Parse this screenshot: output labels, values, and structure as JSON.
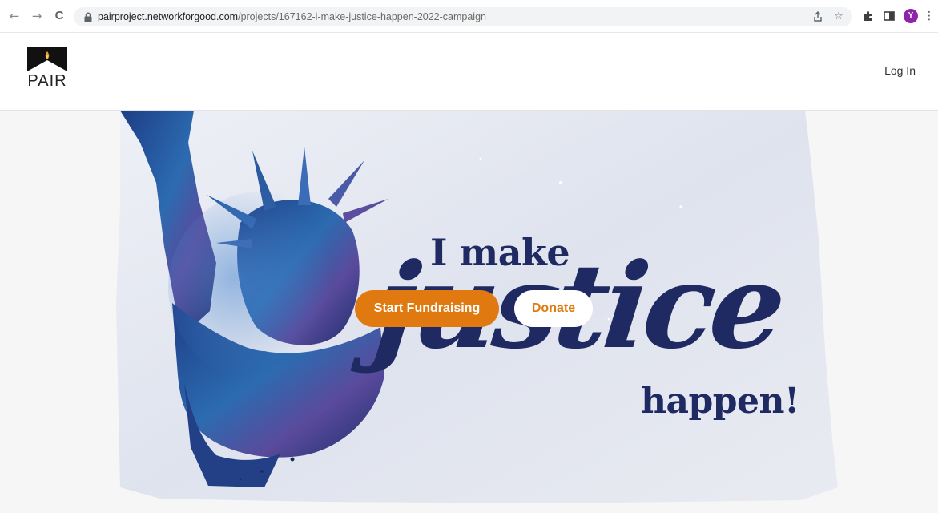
{
  "browser": {
    "back_icon": "←",
    "forward_icon": "→",
    "reload_icon": "C",
    "url_domain": "pairproject.networkforgood.com",
    "url_path": "/projects/167162-i-make-justice-happen-2022-campaign",
    "share_icon": "share-icon",
    "bookmark_icon": "☆",
    "extensions_icon": "puzzle-icon",
    "sidepanel_icon": "sidepanel-icon",
    "profile_initial": "Y",
    "menu_icon": "⋮",
    "profile_color": "#8e24aa"
  },
  "header": {
    "logo_text": "PAIR",
    "login_label": "Log In"
  },
  "hero": {
    "line1": "I make",
    "line2": "justice",
    "line3": "happen!",
    "start_fundraising_label": "Start Fundraising",
    "donate_label": "Donate",
    "accent_color": "#e07a10",
    "text_color": "#1f2a62"
  }
}
